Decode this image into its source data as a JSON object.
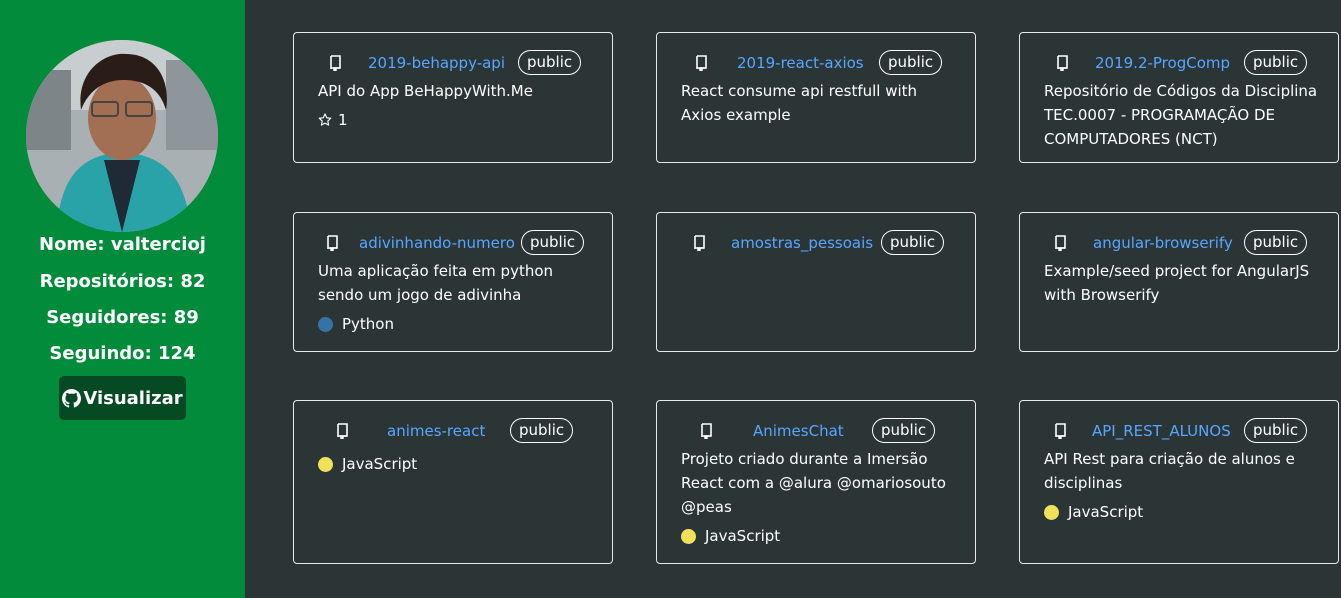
{
  "profile": {
    "name_label": "Nome: valtercioj",
    "repos_label": "Repositórios: 82",
    "followers_label": "Seguidores: 89",
    "following_label": "Seguindo: 124",
    "view_button": "Visualizar"
  },
  "colors": {
    "sidebar": "#038b3c",
    "button": "#064a24",
    "background": "#2b3536",
    "link": "#58a6ff",
    "python": "#3572A5",
    "javascript": "#f1e05a"
  },
  "repos": [
    {
      "name": "2019-behappy-api",
      "visibility": "public",
      "description": "API do App BeHappyWith.Me",
      "stars": "1",
      "language": ""
    },
    {
      "name": "2019-react-axios",
      "visibility": "public",
      "description": "React consume api restfull with Axios example",
      "language": ""
    },
    {
      "name": "2019.2-ProgComp",
      "visibility": "public",
      "description": "Repositório de Códigos da Disciplina TEC.0007 - PROGRAMAÇÃO DE COMPUTADORES (NCT)",
      "language": ""
    },
    {
      "name": "adivinhando-numero",
      "visibility": "public",
      "description": "Uma aplicação feita em python sendo um jogo de adivinha",
      "language": "Python"
    },
    {
      "name": "amostras_pessoais",
      "visibility": "public",
      "description": "",
      "language": ""
    },
    {
      "name": "angular-browserify",
      "visibility": "public",
      "description": "Example/seed project for AngularJS with Browserify",
      "language": ""
    },
    {
      "name": "animes-react",
      "visibility": "public",
      "description": "",
      "language": "JavaScript"
    },
    {
      "name": "AnimesChat",
      "visibility": "public",
      "description": "Projeto criado durante a Imersão React com a @alura @omariosouto @peas",
      "language": "JavaScript"
    },
    {
      "name": "API_REST_ALUNOS",
      "visibility": "public",
      "description": "API Rest para criação de alunos e disciplinas",
      "language": "JavaScript"
    }
  ]
}
